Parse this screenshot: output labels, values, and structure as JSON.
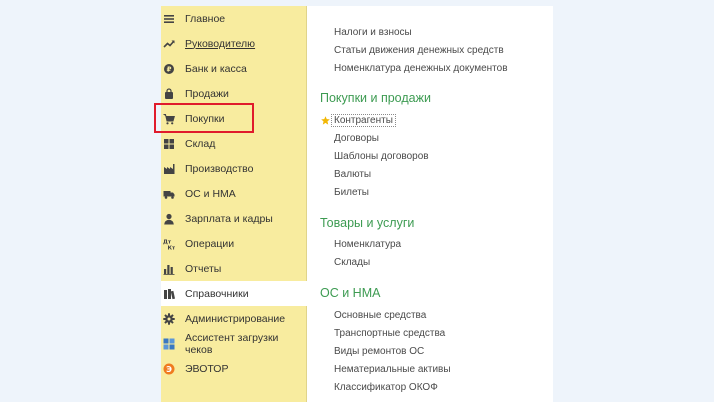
{
  "sidebar": {
    "items": [
      {
        "label": "Главное",
        "icon": "menu-icon"
      },
      {
        "label": "Руководителю",
        "icon": "trend-icon",
        "link": true
      },
      {
        "label": "Банк и касса",
        "icon": "coin-icon"
      },
      {
        "label": "Продажи",
        "icon": "bag-icon"
      },
      {
        "label": "Покупки",
        "icon": "cart-icon"
      },
      {
        "label": "Склад",
        "icon": "warehouse-icon"
      },
      {
        "label": "Производство",
        "icon": "factory-icon"
      },
      {
        "label": "ОС и НМА",
        "icon": "truck-icon"
      },
      {
        "label": "Зарплата и кадры",
        "icon": "person-icon"
      },
      {
        "label": "Операции",
        "icon": "dt-kt-icon"
      },
      {
        "label": "Отчеты",
        "icon": "bar-chart-icon"
      },
      {
        "label": "Справочники",
        "icon": "books-icon",
        "active": true
      },
      {
        "label": "Администрирование",
        "icon": "gear-icon"
      },
      {
        "label": "Ассистент загрузки чеков",
        "icon": "grid-icon"
      },
      {
        "label": "ЭВОТОР",
        "icon": "evotor-icon"
      }
    ]
  },
  "content": {
    "top_links": [
      "Налоги и взносы",
      "Статьи движения денежных средств",
      "Номенклатура денежных документов"
    ],
    "sections": [
      {
        "title": "Покупки и продажи",
        "links": [
          "Контрагенты",
          "Договоры",
          "Шаблоны договоров",
          "Валюты",
          "Билеты"
        ]
      },
      {
        "title": "Товары и услуги",
        "links": [
          "Номенклатура",
          "Склады"
        ]
      },
      {
        "title": "ОС и НМА",
        "links": [
          "Основные средства",
          "Транспортные средства",
          "Виды ремонтов ОС",
          "Нематериальные активы",
          "Классификатор ОКОФ"
        ]
      }
    ]
  },
  "colors": {
    "sidebar_bg": "#f8ec9f",
    "section_title": "#3d9b52",
    "highlight": "#e01b2c",
    "star": "#f2b705"
  }
}
